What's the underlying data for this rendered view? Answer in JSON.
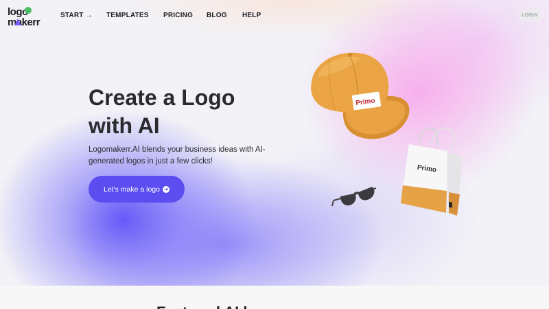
{
  "nav": {
    "logo_line1": "logo",
    "logo_line2": "makerr",
    "items": [
      {
        "label": "START →"
      },
      {
        "label": "TEMPLATES"
      },
      {
        "label": "PRICING"
      },
      {
        "label": "BLOG"
      },
      {
        "label": "HELP"
      }
    ],
    "login_label": "LOGIN"
  },
  "hero": {
    "title_line1": "Create a Logo",
    "title_line2": "with AI",
    "description": "Logomakerr.AI blends your business ideas with AI-generated logos in just a few clicks!",
    "cta_label": "Let's make a logo",
    "cta_icon": "arrow-right-circle-icon",
    "cap_brand": "Primo",
    "bag_brand": "Primo"
  },
  "next_section": {
    "heading_start": "Featured AI l",
    "heading_accent": "g"
  },
  "colors": {
    "accent": "#5b4df0",
    "logo_green": "#4cc063",
    "logo_purple": "#7b5cf6",
    "cap_orange": "#e8a23f",
    "text_dark": "#2a2b2f"
  }
}
